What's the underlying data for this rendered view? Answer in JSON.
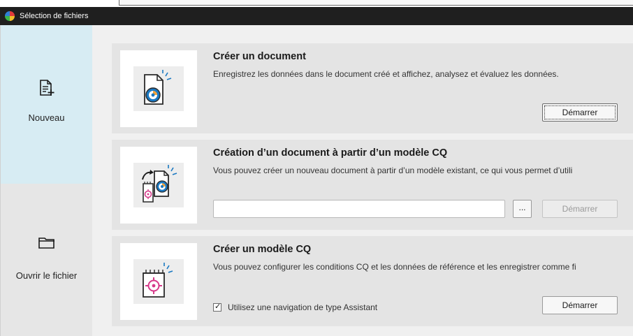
{
  "window": {
    "title": "Sélection de fichiers"
  },
  "sidebar": {
    "items": [
      {
        "label": "Nouveau",
        "icon": "new-document-icon",
        "active": true
      },
      {
        "label": "Ouvrir le fichier",
        "icon": "folder-icon",
        "active": false
      }
    ]
  },
  "cards": [
    {
      "title": "Créer un document",
      "description": "Enregistrez les données dans le document créé et affichez, analysez et évaluez les données.",
      "icon": "create-document-icon",
      "button_label": "Démarrer",
      "button_state": "focused"
    },
    {
      "title": "Création d’un document à partir d’un modèle CQ",
      "description": "Vous pouvez créer un nouveau document à partir d’un modèle existant, ce qui vous permet d’utili",
      "icon": "document-from-template-icon",
      "path_value": "",
      "browse_label": "...",
      "button_label": "Démarrer",
      "button_state": "disabled"
    },
    {
      "title": "Créer un modèle CQ",
      "description": "Vous pouvez configurer les conditions CQ et les données de référence et les enregistrer comme fi",
      "icon": "qc-template-icon",
      "checkbox_label": "Utilisez une navigation de type Assistant",
      "checkbox_checked": true,
      "button_label": "Démarrer",
      "button_state": "normal"
    }
  ],
  "colors": {
    "titlebar": "#1f1f1f",
    "sidebar_active": "#d7ecf3",
    "card_background": "#e4e4e4",
    "accent_blue": "#1a78c2",
    "accent_orange": "#f2a33a",
    "accent_pink": "#d63a8a"
  }
}
